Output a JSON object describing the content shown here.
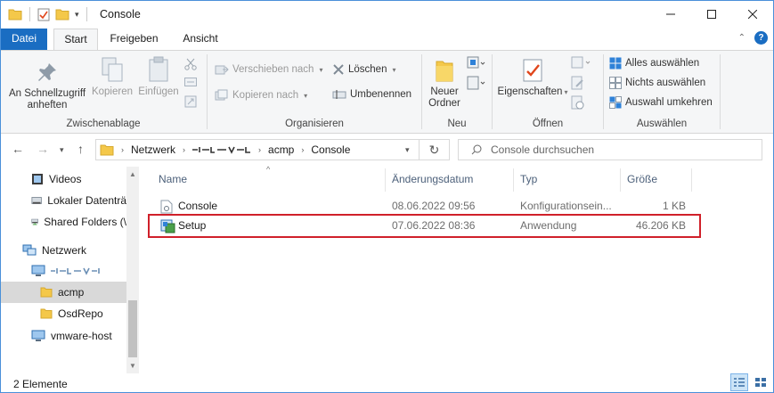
{
  "window": {
    "title": "Console"
  },
  "tabs": {
    "datei": "Datei",
    "start": "Start",
    "freigeben": "Freigeben",
    "ansicht": "Ansicht"
  },
  "ribbon": {
    "pin_label_1": "An Schnellzugriff",
    "pin_label_2": "anheften",
    "copy": "Kopieren",
    "paste": "Einfügen",
    "group_clipboard": "Zwischenablage",
    "move_to": "Verschieben nach",
    "copy_to": "Kopieren nach",
    "delete": "Löschen",
    "rename": "Umbenennen",
    "group_organize": "Organisieren",
    "new_folder_1": "Neuer",
    "new_folder_2": "Ordner",
    "group_new": "Neu",
    "properties": "Eigenschaften",
    "group_open": "Öffnen",
    "select_all": "Alles auswählen",
    "select_none": "Nichts auswählen",
    "invert_selection": "Auswahl umkehren",
    "group_select": "Auswählen"
  },
  "address": {
    "crumbs": [
      "Netzwerk",
      "acmp",
      "Console"
    ],
    "search_placeholder": "Console durchsuchen"
  },
  "nav": {
    "items": [
      {
        "label": "Videos",
        "icon": "video-folder-icon"
      },
      {
        "label": "Lokaler Datenträ",
        "icon": "drive-icon"
      },
      {
        "label": "Shared Folders (\\",
        "icon": "network-drive-icon"
      },
      {
        "label": "Netzwerk",
        "icon": "network-icon"
      },
      {
        "label": "acmp",
        "icon": "folder-icon"
      },
      {
        "label": "OsdRepo",
        "icon": "folder-icon"
      },
      {
        "label": "vmware-host",
        "icon": "computer-icon"
      }
    ]
  },
  "columns": {
    "name": "Name",
    "date": "Änderungsdatum",
    "type": "Typ",
    "size": "Größe"
  },
  "files": [
    {
      "name": "Console",
      "date": "08.06.2022 09:56",
      "type": "Konfigurationsein...",
      "size": "1 KB"
    },
    {
      "name": "Setup",
      "date": "07.06.2022 08:36",
      "type": "Anwendung",
      "size": "46.206 KB"
    }
  ],
  "status": {
    "count": "2 Elemente"
  },
  "colors": {
    "accent": "#1a6dc2",
    "highlight": "#d0202a",
    "folder": "#f4c84a"
  }
}
